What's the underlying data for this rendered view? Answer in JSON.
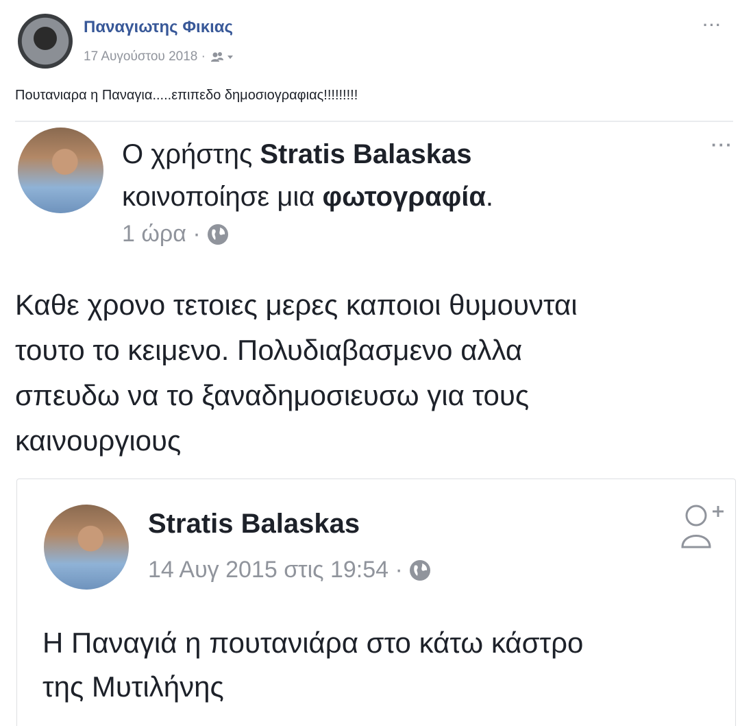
{
  "top_post": {
    "author": "Παναγιωτης Φικιας",
    "date": "17 Αυγούστου 2018 ·",
    "text": "Πουτανιαρα η Παναγια.....επιπεδο δημοσιογραφιας!!!!!!!!!",
    "more": "···"
  },
  "shared_post": {
    "prefix": "Ο χρήστης ",
    "author": "Stratis Balaskas",
    "line2_prefix": "κοινοποίησε μια ",
    "line2_bold": "φωτογραφία",
    "line2_suffix": ".",
    "time": "1 ώρα ·",
    "more": "···",
    "text_lines": [
      "Καθε χρονο τετοιες μερες καποιοι θυμουνται",
      "τουτο το κειμενο. Πολυδιαβασμενο αλλα",
      "σπευδω να το ξαναδημοσιευσω για τους",
      "καινουργιους"
    ]
  },
  "original_post": {
    "author": "Stratis Balaskas",
    "date": "14 Αυγ 2015 στις 19:54 ·",
    "text_lines": [
      "Η Παναγιά η πουτανιάρα στο κάτω κάστρο",
      "της Μυτιλήνης"
    ]
  }
}
